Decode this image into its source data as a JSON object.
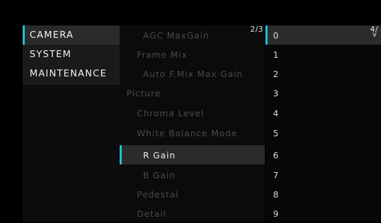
{
  "menu": {
    "categories": [
      {
        "label": "CAMERA",
        "selected": true
      },
      {
        "label": "SYSTEM",
        "selected": false
      },
      {
        "label": "MAINTENANCE",
        "selected": false
      }
    ],
    "page_indicator": "2/3",
    "items": [
      {
        "label": "AGC MaxGain"
      },
      {
        "label": "Frame Mix"
      },
      {
        "label": "Auto F.Mix Max Gain"
      },
      {
        "label": "Picture"
      },
      {
        "label": "Chroma Level"
      },
      {
        "label": "White Balance Mode"
      },
      {
        "label": "R Gain"
      },
      {
        "label": "B Gain"
      },
      {
        "label": "Pedestal"
      },
      {
        "label": "Detail"
      }
    ]
  },
  "values": {
    "page_indicator": "4/",
    "page_arrow": "v",
    "options": [
      "0",
      "1",
      "2",
      "3",
      "4",
      "5",
      "6",
      "7",
      "8",
      "9"
    ]
  },
  "colors": {
    "accent": "#22c4d6"
  }
}
